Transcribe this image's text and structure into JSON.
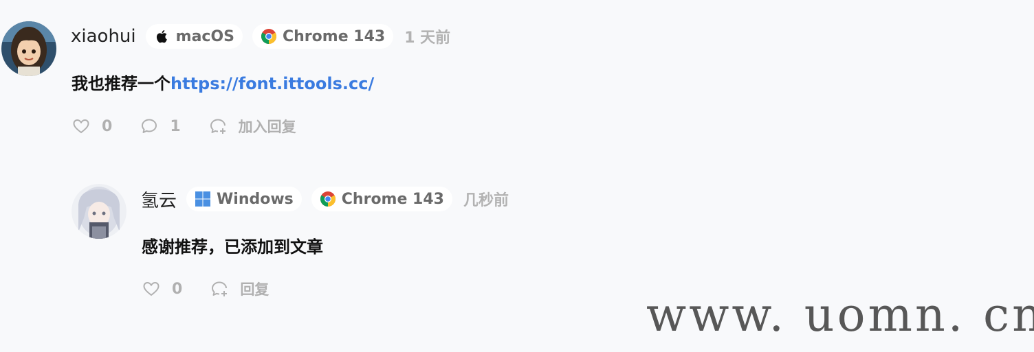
{
  "comments": [
    {
      "author": "xiaohui",
      "os": {
        "label": "macOS",
        "icon": "apple-icon"
      },
      "browser": {
        "label": "Chrome 143",
        "icon": "chrome-icon"
      },
      "time": "1 天前",
      "content_text": "我也推荐一个",
      "content_link": "https://font.ittools.cc/",
      "likes": "0",
      "replies_count": "1",
      "reply_label": "加入回复"
    },
    {
      "author": "氢云",
      "os": {
        "label": "Windows",
        "icon": "windows-icon"
      },
      "browser": {
        "label": "Chrome 143",
        "icon": "chrome-icon"
      },
      "time": "几秒前",
      "content_text": "感谢推荐，已添加到文章",
      "likes": "0",
      "reply_label": "回复"
    }
  ],
  "watermark": "www. uomn. cn",
  "colors": {
    "background": "#f8f9fb",
    "link": "#3a7be0",
    "muted": "#b0b0b0",
    "chip_text": "#6a6a6a"
  }
}
